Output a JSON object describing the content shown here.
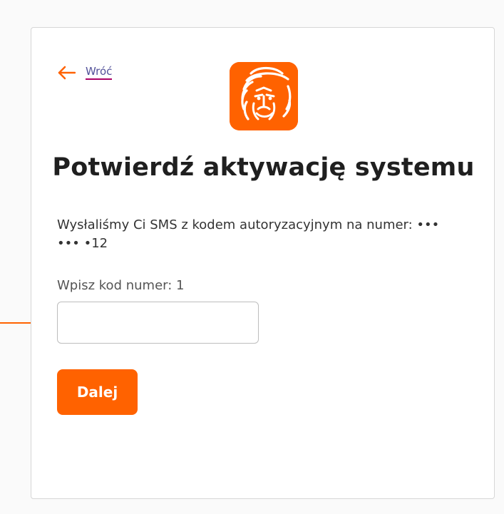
{
  "back": {
    "label": "Wróć",
    "icon": "arrow-left-icon"
  },
  "logo": {
    "icon": "lion-logo-icon",
    "brand_color": "#ff6200"
  },
  "title": "Potwierdź aktywację systemu",
  "info_text": "Wysłaliśmy Ci SMS z kodem autoryzacyjnym na numer: ••• ••• •12",
  "code_field": {
    "label": "Wpisz kod numer: 1",
    "value": "",
    "placeholder": ""
  },
  "next_button": {
    "label": "Dalej"
  },
  "colors": {
    "accent": "#ff6200",
    "link": "#525199",
    "link_underline": "#ab0066",
    "title": "#1f1f1f"
  }
}
